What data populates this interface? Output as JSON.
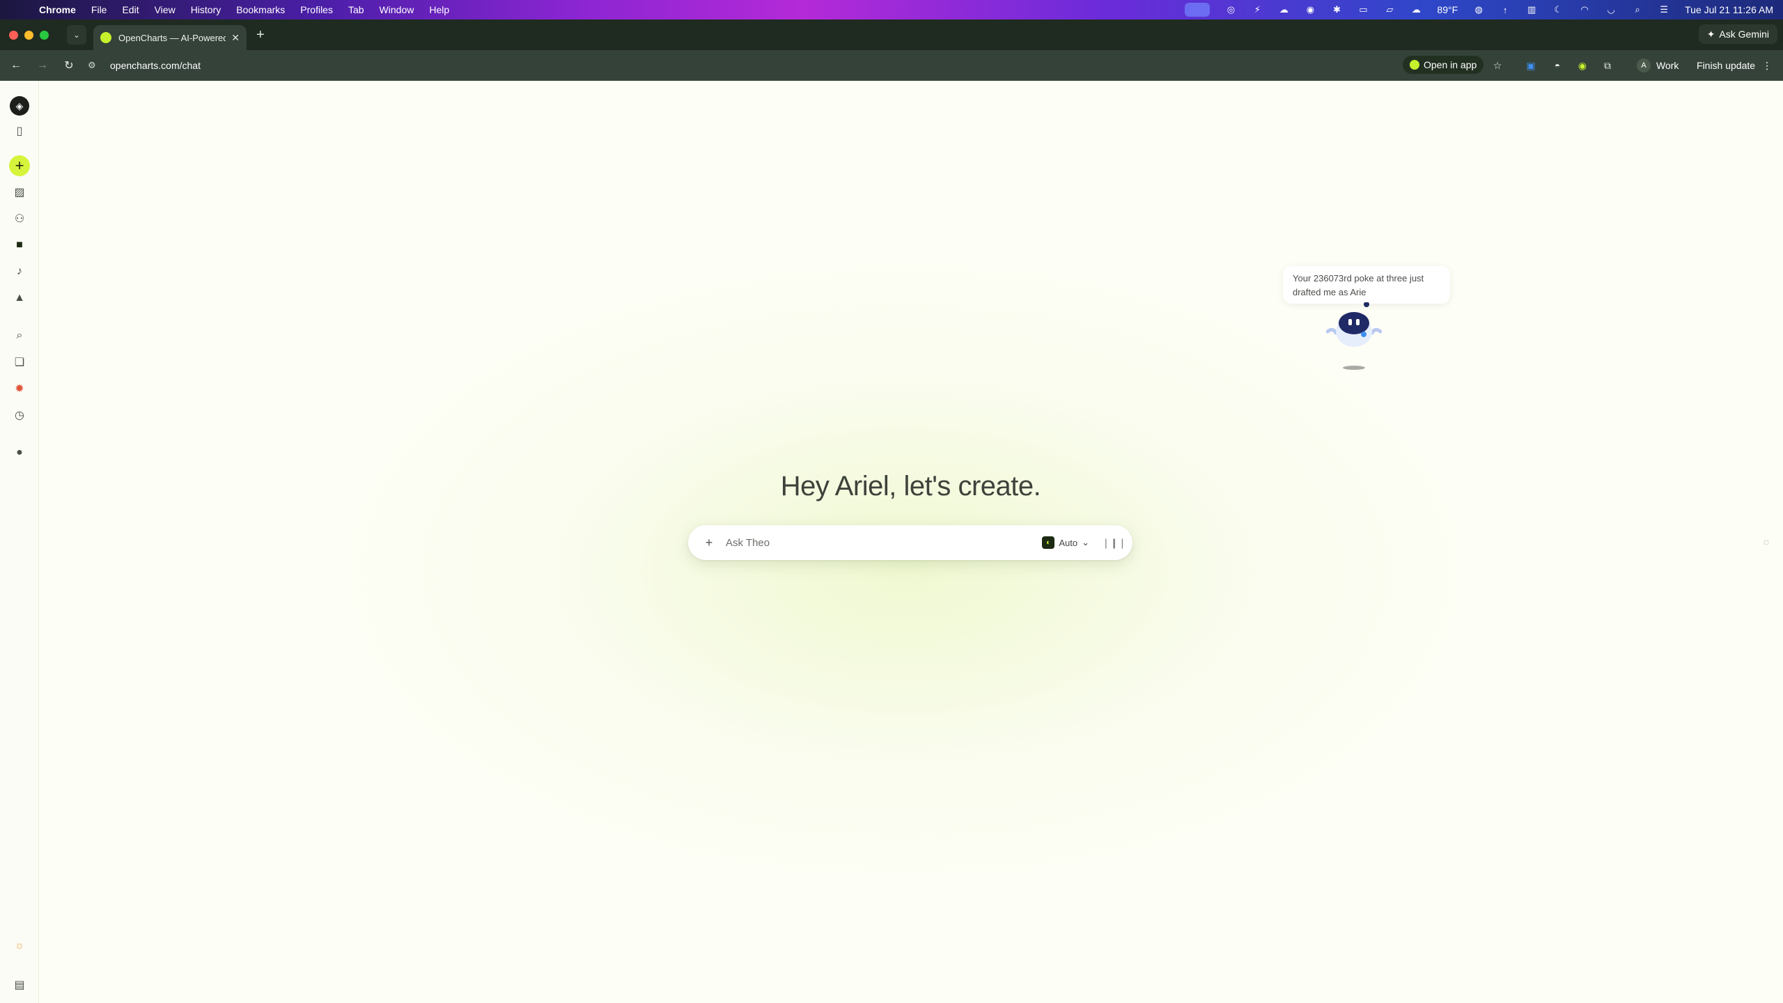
{
  "menubar": {
    "app": "Chrome",
    "items": [
      "File",
      "Edit",
      "View",
      "History",
      "Bookmarks",
      "Profiles",
      "Tab",
      "Window",
      "Help"
    ],
    "weather": "89°F",
    "datetime": "Tue Jul 21  11:26 AM"
  },
  "browser": {
    "tab_title": "OpenCharts — AI-Powered Fi",
    "url": "opencharts.com/chat",
    "ask_gemini": "Ask Gemini",
    "open_in_app": "Open in app",
    "profile_initial": "A",
    "profile_name": "Work",
    "finish_update": "Finish update"
  },
  "main": {
    "greeting": "Hey Ariel, let's create.",
    "chat_placeholder": "Ask Theo",
    "model": "Auto",
    "mascot_message": "Your 236073rd poke at three just drafted me as Arie"
  },
  "colors": {
    "accent": "#d6f43b",
    "background": "#fdfef5"
  }
}
